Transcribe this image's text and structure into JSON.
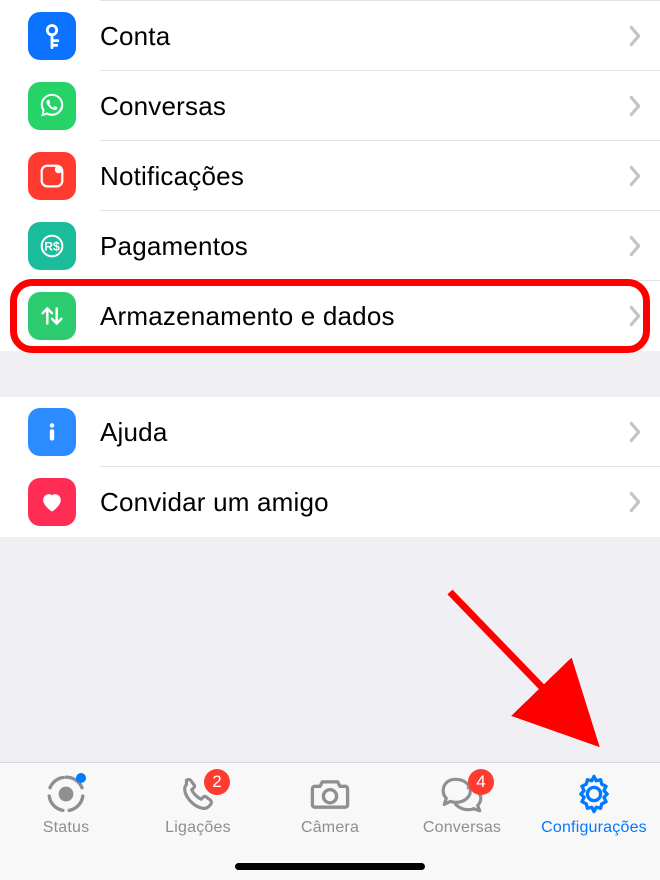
{
  "settings_section1": {
    "items": [
      {
        "label": "Conta"
      },
      {
        "label": "Conversas"
      },
      {
        "label": "Notificações"
      },
      {
        "label": "Pagamentos"
      },
      {
        "label": "Armazenamento e dados"
      }
    ]
  },
  "settings_section2": {
    "items": [
      {
        "label": "Ajuda"
      },
      {
        "label": "Convidar um amigo"
      }
    ]
  },
  "tabbar": {
    "items": [
      {
        "label": "Status",
        "badge": null,
        "active": false,
        "has_status_dot": true
      },
      {
        "label": "Ligações",
        "badge": "2",
        "active": false
      },
      {
        "label": "Câmera",
        "badge": null,
        "active": false
      },
      {
        "label": "Conversas",
        "badge": "4",
        "active": false
      },
      {
        "label": "Configurações",
        "badge": null,
        "active": true
      }
    ]
  },
  "annotations": {
    "highlighted_item": "Armazenamento e dados",
    "arrow_target_tab": "Configurações"
  }
}
